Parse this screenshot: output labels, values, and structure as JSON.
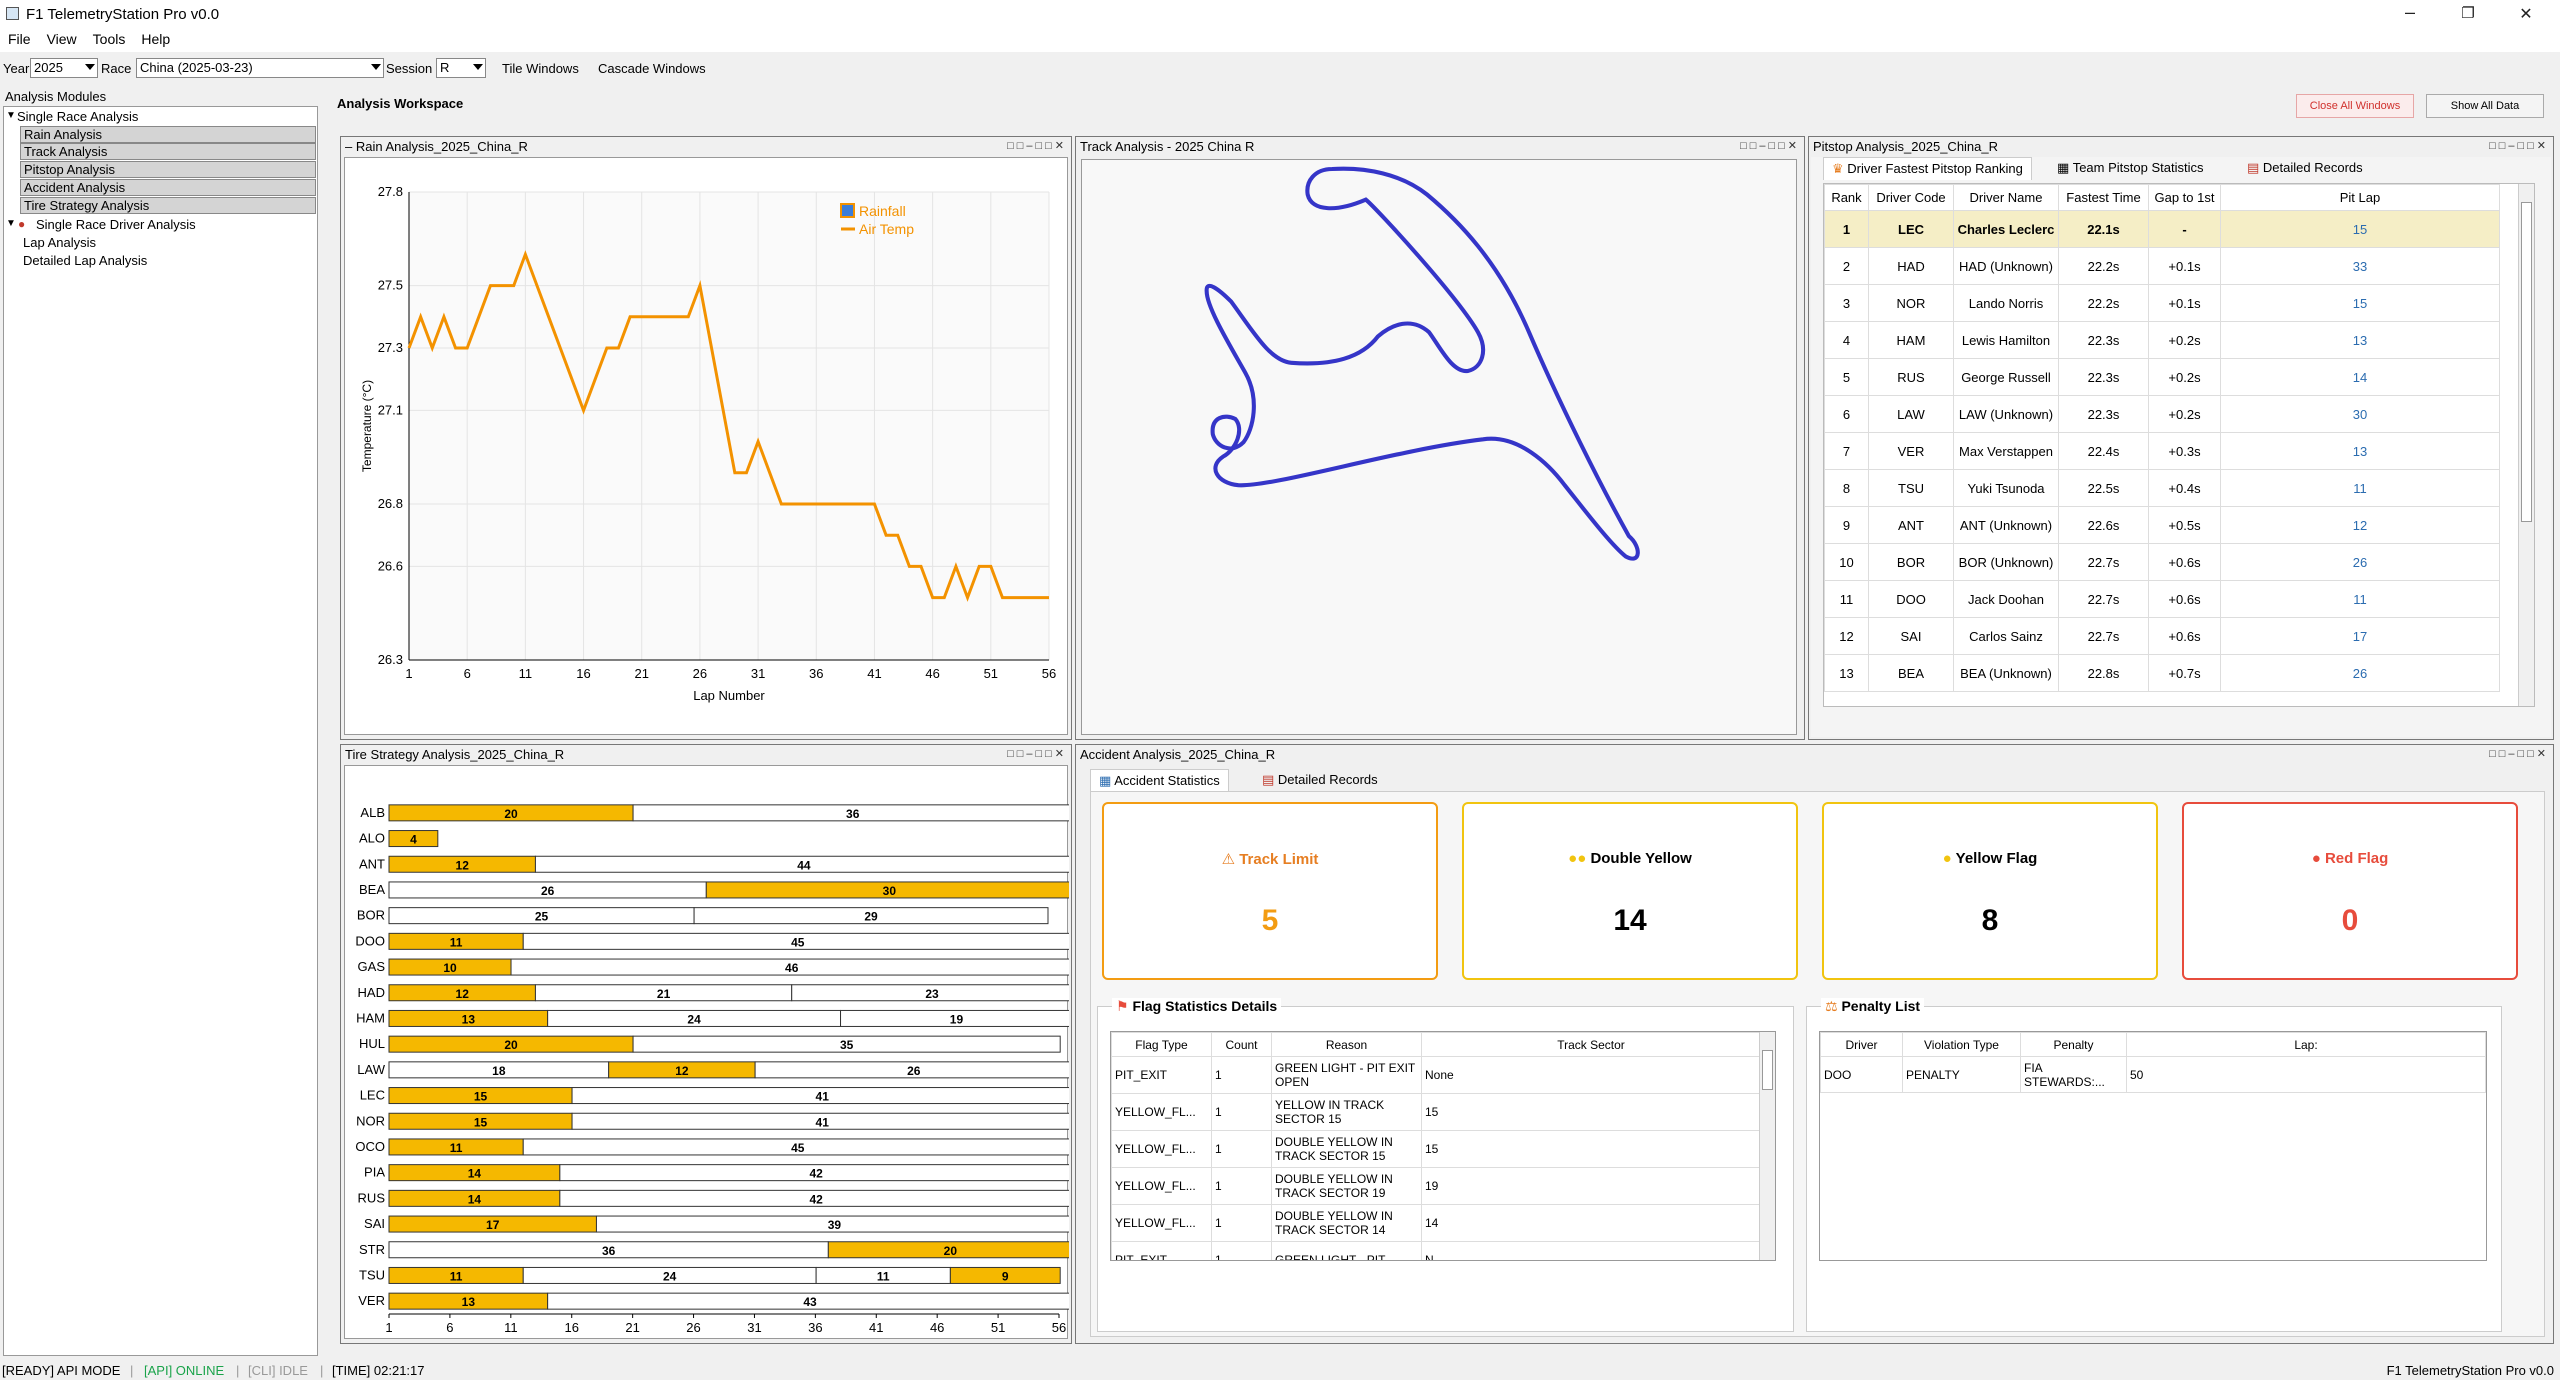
{
  "window": {
    "title": "F1 TelemetryStation Pro v0.0",
    "controls": [
      "–",
      "❐",
      "✕"
    ]
  },
  "menu": [
    "File",
    "View",
    "Tools",
    "Help"
  ],
  "toolbar": {
    "year_label": "Year",
    "year_value": "2025",
    "race_label": "Race",
    "race_value": "China (2025-03-23)",
    "session_label": "Session",
    "session_value": "R",
    "tile": "Tile Windows",
    "cascade": "Cascade Windows"
  },
  "sidebar": {
    "title": "Analysis Modules",
    "group1": "Single Race Analysis",
    "items1": [
      "Rain Analysis",
      "Track Analysis",
      "Pitstop Analysis",
      "Accident Analysis",
      "Tire Strategy Analysis"
    ],
    "group2": "Single Race Driver Analysis",
    "items2": [
      "Lap Analysis",
      "Detailed Lap Analysis"
    ]
  },
  "workspace": {
    "title": "Analysis Workspace",
    "close_all": "Close All Windows",
    "show_all": "Show All Data"
  },
  "rain": {
    "title": "Rain Analysis_2025_China_R",
    "legend": [
      "Rainfall",
      "Air Temp"
    ],
    "xlabel": "Lap Number",
    "ylabel": "Temperature (°C)",
    "yticks": [
      "27.8",
      "27.5",
      "27.3",
      "27.1",
      "26.8",
      "26.6",
      "26.3"
    ],
    "xticks": [
      "1",
      "6",
      "11",
      "16",
      "21",
      "26",
      "31",
      "36",
      "41",
      "46",
      "51",
      "56"
    ]
  },
  "track": {
    "title": "Track Analysis - 2025 China R"
  },
  "pitstop": {
    "title": "Pitstop Analysis_2025_China_R",
    "tabs": [
      "Driver Fastest Pitstop Ranking",
      "Team Pitstop Statistics",
      "Detailed Records"
    ],
    "headers": [
      "Rank",
      "Driver Code",
      "Driver Name",
      "Fastest Time",
      "Gap to 1st",
      "Pit Lap"
    ],
    "rows": [
      [
        "1",
        "LEC",
        "Charles Leclerc",
        "22.1s",
        "-",
        "15"
      ],
      [
        "2",
        "HAD",
        "HAD (Unknown)",
        "22.2s",
        "+0.1s",
        "33"
      ],
      [
        "3",
        "NOR",
        "Lando Norris",
        "22.2s",
        "+0.1s",
        "15"
      ],
      [
        "4",
        "HAM",
        "Lewis Hamilton",
        "22.3s",
        "+0.2s",
        "13"
      ],
      [
        "5",
        "RUS",
        "George Russell",
        "22.3s",
        "+0.2s",
        "14"
      ],
      [
        "6",
        "LAW",
        "LAW (Unknown)",
        "22.3s",
        "+0.2s",
        "30"
      ],
      [
        "7",
        "VER",
        "Max Verstappen",
        "22.4s",
        "+0.3s",
        "13"
      ],
      [
        "8",
        "TSU",
        "Yuki Tsunoda",
        "22.5s",
        "+0.4s",
        "11"
      ],
      [
        "9",
        "ANT",
        "ANT (Unknown)",
        "22.6s",
        "+0.5s",
        "12"
      ],
      [
        "10",
        "BOR",
        "BOR (Unknown)",
        "22.7s",
        "+0.6s",
        "26"
      ],
      [
        "11",
        "DOO",
        "Jack Doohan",
        "22.7s",
        "+0.6s",
        "11"
      ],
      [
        "12",
        "SAI",
        "Carlos Sainz",
        "22.7s",
        "+0.6s",
        "17"
      ],
      [
        "13",
        "BEA",
        "BEA (Unknown)",
        "22.8s",
        "+0.7s",
        "26"
      ]
    ]
  },
  "tire": {
    "title": "Tire Strategy Analysis_2025_China_R",
    "xlabel": "Lap Number",
    "xticks": [
      "1",
      "6",
      "11",
      "16",
      "21",
      "26",
      "31",
      "36",
      "41",
      "46",
      "51",
      "56"
    ]
  },
  "accident": {
    "title": "Accident Analysis_2025_China_R",
    "tabs": [
      "Accident Statistics",
      "Detailed Records"
    ],
    "cards": [
      {
        "label": "Track Limit",
        "value": "5",
        "color": "#f39c12",
        "icon": "warning-icon"
      },
      {
        "label": "Double Yellow",
        "value": "14",
        "color": "#f1c40f",
        "icon": "double-dot-icon"
      },
      {
        "label": "Yellow Flag",
        "value": "8",
        "color": "#f1c40f",
        "icon": "yellow-dot-icon"
      },
      {
        "label": "Red Flag",
        "value": "0",
        "color": "#e74c3c",
        "icon": "red-dot-icon"
      }
    ],
    "flag_title": "Flag Statistics Details",
    "flag_headers": [
      "Flag Type",
      "Count",
      "Reason",
      "Track Sector"
    ],
    "flag_rows": [
      [
        "PIT_EXIT",
        "1",
        "GREEN LIGHT - PIT EXIT OPEN",
        "None"
      ],
      [
        "YELLOW_FL...",
        "1",
        "YELLOW IN TRACK SECTOR 15",
        "15"
      ],
      [
        "YELLOW_FL...",
        "1",
        "DOUBLE YELLOW IN TRACK SECTOR 15",
        "15"
      ],
      [
        "YELLOW_FL...",
        "1",
        "DOUBLE YELLOW IN TRACK SECTOR 19",
        "19"
      ],
      [
        "YELLOW_FL...",
        "1",
        "DOUBLE YELLOW IN TRACK SECTOR 14",
        "14"
      ],
      [
        "PIT_EXIT",
        "1",
        "GREEN LIGHT - PIT",
        "N"
      ]
    ],
    "penalty_title": "Penalty List",
    "penalty_headers": [
      "Driver",
      "Violation Type",
      "Penalty",
      "Lap:"
    ],
    "penalty_rows": [
      [
        "DOO",
        "PENALTY",
        "FIA STEWARDS:...",
        "50"
      ]
    ]
  },
  "status": {
    "ready": "[READY] API MODE",
    "api": "[API] ONLINE",
    "cli": "[CLI] IDLE",
    "time": "[TIME] 02:21:17",
    "right": "F1 TelemetryStation Pro v0.0",
    "colors": {
      "api": "#1aa34a",
      "cli": "#999999"
    }
  },
  "chart_data": [
    {
      "type": "line",
      "title": "",
      "xlabel": "Lap Number",
      "ylabel": "Temperature (°C)",
      "ylim": [
        26.3,
        27.8
      ],
      "xlim": [
        1,
        56
      ],
      "series": [
        {
          "name": "Rainfall",
          "values": []
        },
        {
          "name": "Air Temp",
          "x": [
            1,
            2,
            3,
            4,
            5,
            6,
            7,
            8,
            9,
            10,
            11,
            12,
            13,
            14,
            15,
            16,
            17,
            18,
            19,
            20,
            21,
            22,
            23,
            24,
            25,
            26,
            27,
            28,
            29,
            30,
            31,
            32,
            33,
            34,
            35,
            36,
            37,
            38,
            39,
            40,
            41,
            42,
            43,
            44,
            45,
            46,
            47,
            48,
            49,
            50,
            51,
            52,
            53,
            54,
            55,
            56
          ],
          "values": [
            27.3,
            27.4,
            27.3,
            27.4,
            27.3,
            27.3,
            27.4,
            27.5,
            27.5,
            27.5,
            27.6,
            27.5,
            27.4,
            27.3,
            27.2,
            27.1,
            27.2,
            27.3,
            27.3,
            27.4,
            27.4,
            27.4,
            27.4,
            27.4,
            27.4,
            27.5,
            27.3,
            27.1,
            26.9,
            26.9,
            27.0,
            26.9,
            26.8,
            26.8,
            26.8,
            26.8,
            26.8,
            26.8,
            26.8,
            26.8,
            26.8,
            26.7,
            26.7,
            26.6,
            26.6,
            26.5,
            26.5,
            26.6,
            26.5,
            26.6,
            26.6,
            26.5,
            26.5,
            26.5,
            26.5,
            26.5
          ]
        }
      ],
      "colors": [
        "#3b7dd8",
        "#f39200"
      ]
    },
    {
      "type": "bar",
      "title": "",
      "xlabel": "Lap Number",
      "xlim": [
        1,
        56
      ],
      "categories": [
        "ALB",
        "ALO",
        "ANT",
        "BEA",
        "BOR",
        "DOO",
        "GAS",
        "HAD",
        "HAM",
        "HUL",
        "LAW",
        "LEC",
        "NOR",
        "OCO",
        "PIA",
        "RUS",
        "SAI",
        "STR",
        "TSU",
        "VER"
      ],
      "stints": [
        [
          [
            20,
            "M"
          ],
          [
            36,
            "H"
          ]
        ],
        [
          [
            4,
            "M"
          ]
        ],
        [
          [
            12,
            "M"
          ],
          [
            44,
            "H"
          ]
        ],
        [
          [
            26,
            "H"
          ],
          [
            30,
            "M"
          ]
        ],
        [
          [
            25,
            "H"
          ],
          [
            29,
            "H"
          ]
        ],
        [
          [
            11,
            "M"
          ],
          [
            45,
            "H"
          ]
        ],
        [
          [
            10,
            "M"
          ],
          [
            46,
            "H"
          ]
        ],
        [
          [
            12,
            "M"
          ],
          [
            21,
            "H"
          ],
          [
            23,
            "H"
          ]
        ],
        [
          [
            13,
            "M"
          ],
          [
            24,
            "H"
          ],
          [
            19,
            "H"
          ]
        ],
        [
          [
            20,
            "M"
          ],
          [
            35,
            "H"
          ]
        ],
        [
          [
            18,
            "H"
          ],
          [
            12,
            "M"
          ],
          [
            26,
            "H"
          ]
        ],
        [
          [
            15,
            "M"
          ],
          [
            41,
            "H"
          ]
        ],
        [
          [
            15,
            "M"
          ],
          [
            41,
            "H"
          ]
        ],
        [
          [
            11,
            "M"
          ],
          [
            45,
            "H"
          ]
        ],
        [
          [
            14,
            "M"
          ],
          [
            42,
            "H"
          ]
        ],
        [
          [
            14,
            "M"
          ],
          [
            42,
            "H"
          ]
        ],
        [
          [
            17,
            "M"
          ],
          [
            39,
            "H"
          ]
        ],
        [
          [
            36,
            "H"
          ],
          [
            20,
            "M"
          ]
        ],
        [
          [
            11,
            "M"
          ],
          [
            24,
            "H"
          ],
          [
            11,
            "H"
          ],
          [
            9,
            "M"
          ]
        ],
        [
          [
            13,
            "M"
          ],
          [
            43,
            "H"
          ]
        ]
      ],
      "colors": {
        "M": "#f5b800",
        "H": "#ffffff"
      }
    }
  ]
}
